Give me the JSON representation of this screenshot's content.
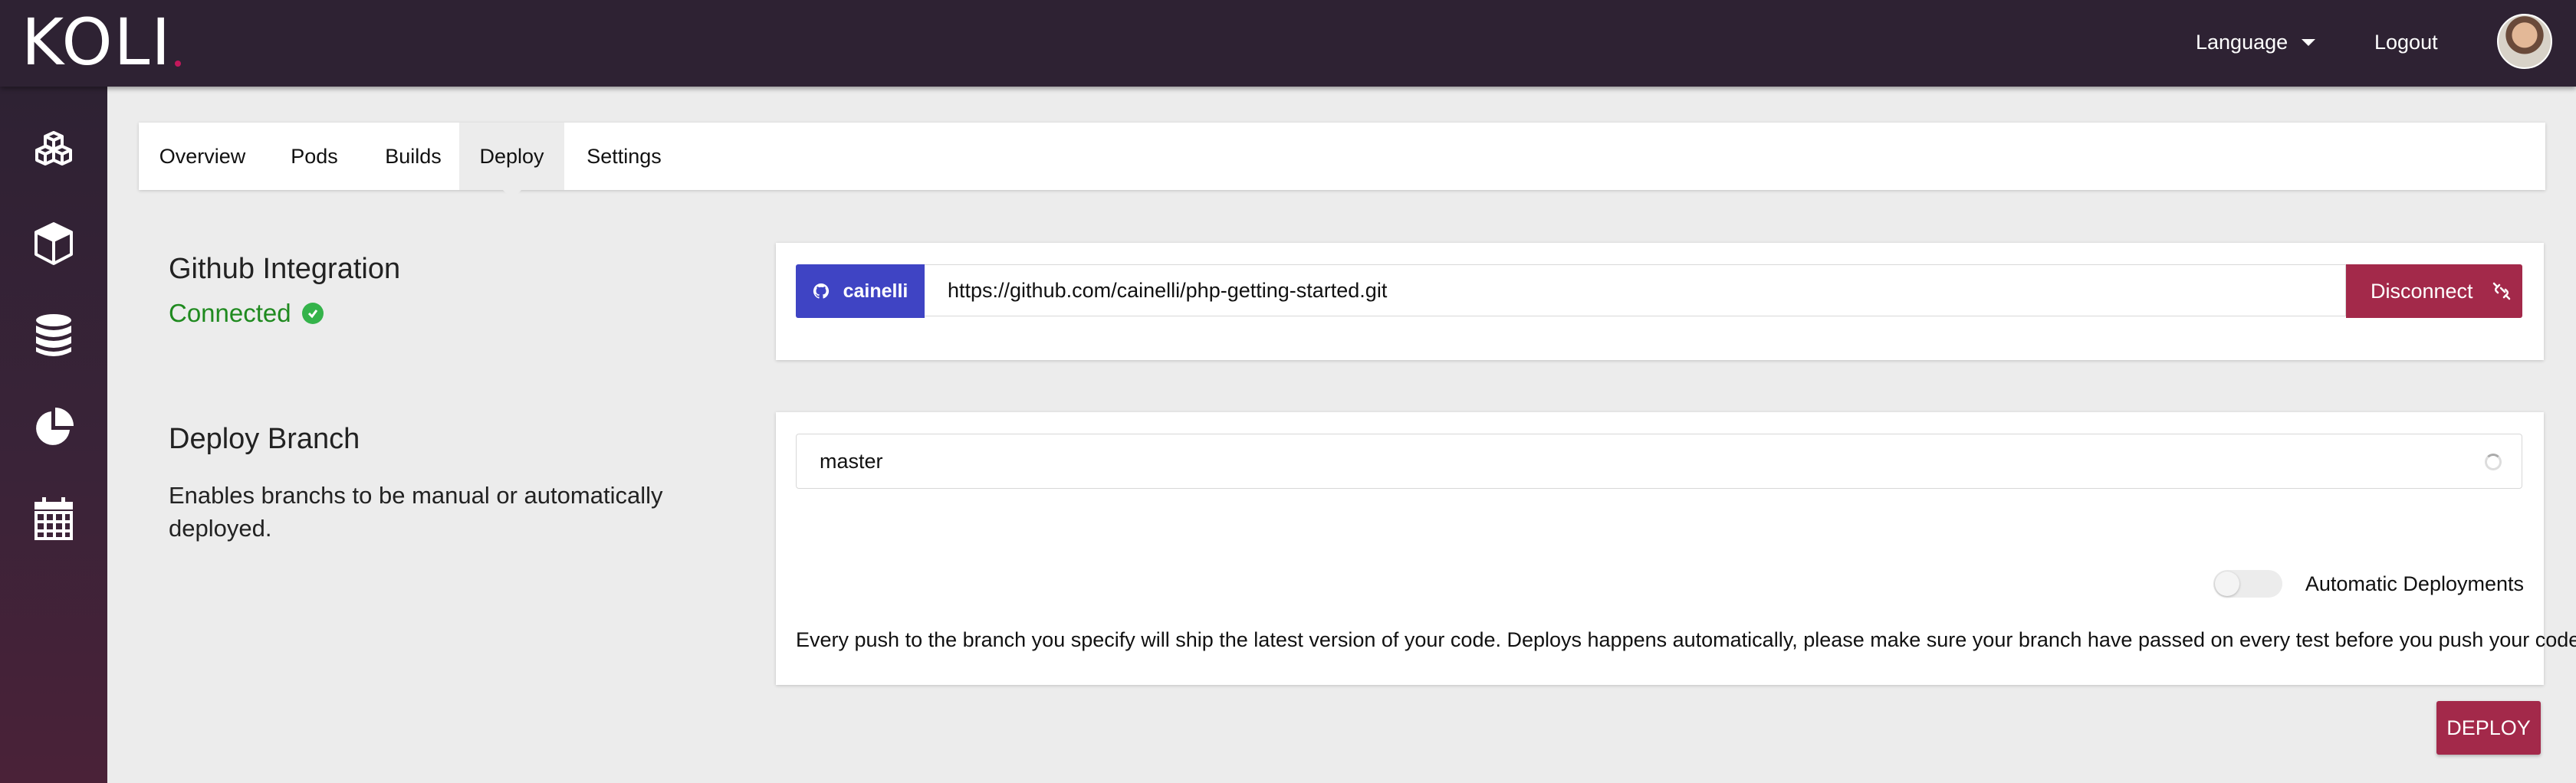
{
  "app": {
    "logo_text": "KOLI"
  },
  "header": {
    "language_label": "Language",
    "logout_label": "Logout"
  },
  "sidebar": {
    "items": [
      {
        "icon": "cubes-icon"
      },
      {
        "icon": "cube-icon"
      },
      {
        "icon": "database-icon"
      },
      {
        "icon": "pie-chart-icon"
      },
      {
        "icon": "calendar-icon"
      }
    ]
  },
  "tabs": [
    {
      "label": "Overview"
    },
    {
      "label": "Pods"
    },
    {
      "label": "Builds"
    },
    {
      "label": "Deploy",
      "active": true
    },
    {
      "label": "Settings"
    }
  ],
  "github": {
    "title": "Github Integration",
    "status": "Connected",
    "user": "cainelli",
    "repo_url": "https://github.com/cainelli/php-getting-started.git",
    "disconnect_label": "Disconnect"
  },
  "deploy_branch": {
    "title": "Deploy Branch",
    "description": "Enables branchs to be manual or automatically deployed.",
    "branch_value": "master",
    "auto_deploy_label": "Automatic Deployments",
    "auto_deploy_enabled": false,
    "help_text": "Every push to the branch you specify will ship the latest version of your code. Deploys happens automatically, please make sure your branch have passed on every test before you push your code.",
    "deploy_button": "DEPLOY"
  },
  "colors": {
    "topbar": "#2e2233",
    "accent": "#a3294a",
    "github_badge": "#3f44c4",
    "connected": "#1f8a1f"
  }
}
